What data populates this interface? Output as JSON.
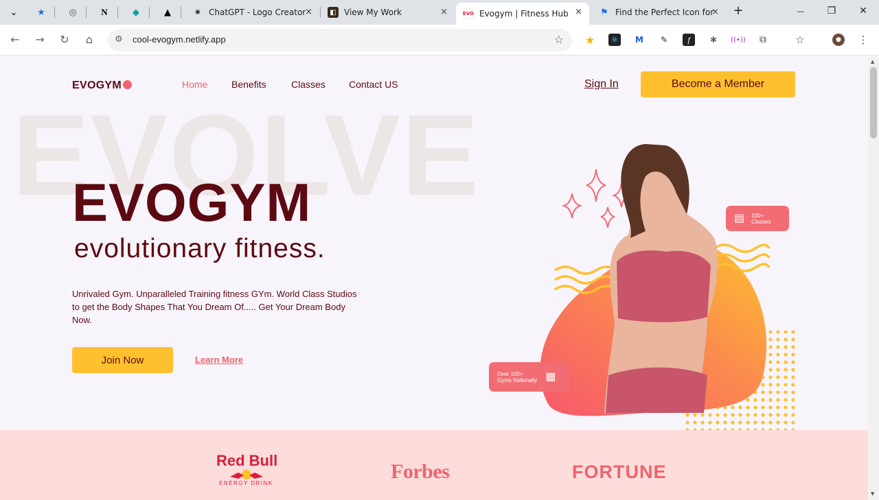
{
  "browser": {
    "tabs": [
      {
        "title": "ChatGPT - Logo Creator",
        "close": "×"
      },
      {
        "title": "View My Work",
        "close": "×"
      },
      {
        "title": "Evogym | Fitness Hub",
        "close": "×",
        "active": true
      },
      {
        "title": "Find the Perfect Icon for",
        "close": "×"
      }
    ],
    "new_tab": "+",
    "controls": {
      "minimize": "—",
      "restore": "❐",
      "close": "✕"
    },
    "url": "cool-evogym.netlify.app"
  },
  "nav": {
    "logo": "EVOGYM",
    "links": [
      "Home",
      "Benefits",
      "Classes",
      "Contact US"
    ],
    "sign_in": "Sign In",
    "cta": "Become a Member"
  },
  "hero": {
    "background_word": "EVOLVE",
    "title": "EVOGYM",
    "subtitle": "evolutionary fitness.",
    "description": "Unrivaled Gym. Unparalleled Training fitness GYm. World Class Studios to get the Body Shapes That You Dream Of..... Get Your Dream Body Now.",
    "join": "Join Now",
    "learn_more": "Learn More",
    "badge_classes": [
      "100+",
      "Classes"
    ],
    "badge_gyms": [
      "Over 100+",
      "Gyms Nationally"
    ]
  },
  "sponsors": {
    "redbull": "Red Bull",
    "redbull_sub": "ENERGY DRINK",
    "forbes": "Forbes",
    "fortune": "FORTUNE"
  },
  "colors": {
    "brand_dark": "#5c0a12",
    "accent_coral": "#f0636b",
    "accent_yellow": "#fec02e",
    "page_bg": "#f8f4fb",
    "sponsor_bg": "#fddcdc"
  }
}
